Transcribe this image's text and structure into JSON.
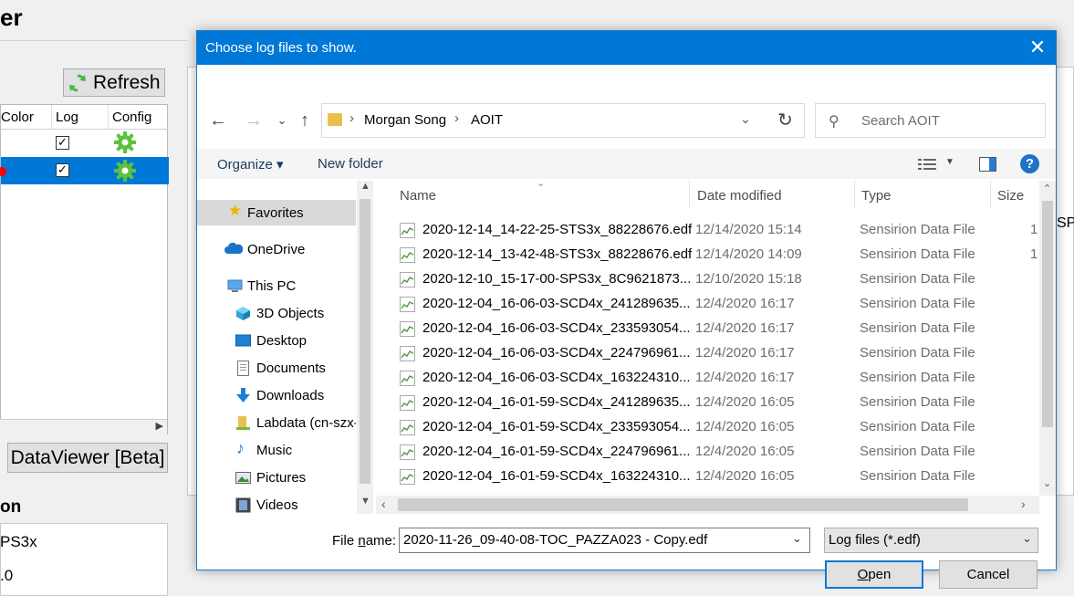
{
  "background_app": {
    "title_fragment": "er",
    "refresh_label": "Refresh",
    "table_headers": [
      "Color",
      "Log",
      "Config"
    ],
    "rows": [
      {
        "log": "✓",
        "selected": false,
        "color": ""
      },
      {
        "log": "✓",
        "selected": true,
        "color": "#ff0000"
      }
    ],
    "dataviewer_label": "DataViewer [Beta]",
    "section_label": "on",
    "info_line1": "PS3x",
    "info_line2": ".0",
    "right_fragment": "SPS"
  },
  "dialog": {
    "title": "Choose log files to show.",
    "close_glyph": "✕",
    "breadcrumb": [
      "Morgan Song",
      "AOIT"
    ],
    "search_placeholder": "Search AOIT",
    "toolbar": {
      "organize": "Organize ▾",
      "new_folder": "New folder",
      "help": "?"
    },
    "nav_items": [
      {
        "label": "Favorites",
        "icon": "star-icon"
      },
      {
        "label": "OneDrive",
        "icon": "cloud-icon"
      },
      {
        "label": "This PC",
        "icon": "computer-icon"
      },
      {
        "label": "3D Objects",
        "icon": "cube-icon"
      },
      {
        "label": "Desktop",
        "icon": "desktop-icon"
      },
      {
        "label": "Documents",
        "icon": "document-icon"
      },
      {
        "label": "Downloads",
        "icon": "download-icon"
      },
      {
        "label": "Labdata (cn-szx-",
        "icon": "network-drive-icon"
      },
      {
        "label": "Music",
        "icon": "music-icon"
      },
      {
        "label": "Pictures",
        "icon": "pictures-icon"
      },
      {
        "label": "Videos",
        "icon": "videos-icon"
      }
    ],
    "columns": [
      "Name",
      "Date modified",
      "Type",
      "Size"
    ],
    "files": [
      {
        "name": "2020-12-14_14-22-25-STS3x_88228676.edf",
        "date": "12/14/2020 15:14",
        "type": "Sensirion Data File",
        "size": "1"
      },
      {
        "name": "2020-12-14_13-42-48-STS3x_88228676.edf",
        "date": "12/14/2020 14:09",
        "type": "Sensirion Data File",
        "size": "1"
      },
      {
        "name": "2020-12-10_15-17-00-SPS3x_8C9621873...",
        "date": "12/10/2020 15:18",
        "type": "Sensirion Data File",
        "size": ""
      },
      {
        "name": "2020-12-04_16-06-03-SCD4x_241289635...",
        "date": "12/4/2020 16:17",
        "type": "Sensirion Data File",
        "size": ""
      },
      {
        "name": "2020-12-04_16-06-03-SCD4x_233593054...",
        "date": "12/4/2020 16:17",
        "type": "Sensirion Data File",
        "size": ""
      },
      {
        "name": "2020-12-04_16-06-03-SCD4x_224796961...",
        "date": "12/4/2020 16:17",
        "type": "Sensirion Data File",
        "size": ""
      },
      {
        "name": "2020-12-04_16-06-03-SCD4x_163224310...",
        "date": "12/4/2020 16:17",
        "type": "Sensirion Data File",
        "size": ""
      },
      {
        "name": "2020-12-04_16-01-59-SCD4x_241289635...",
        "date": "12/4/2020 16:05",
        "type": "Sensirion Data File",
        "size": ""
      },
      {
        "name": "2020-12-04_16-01-59-SCD4x_233593054...",
        "date": "12/4/2020 16:05",
        "type": "Sensirion Data File",
        "size": ""
      },
      {
        "name": "2020-12-04_16-01-59-SCD4x_224796961...",
        "date": "12/4/2020 16:05",
        "type": "Sensirion Data File",
        "size": ""
      },
      {
        "name": "2020-12-04_16-01-59-SCD4x_163224310...",
        "date": "12/4/2020 16:05",
        "type": "Sensirion Data File",
        "size": ""
      }
    ],
    "file_name_label_pre": "File ",
    "file_name_label_ul": "n",
    "file_name_label_post": "ame:",
    "file_name_value": "2020-11-26_09-40-08-TOC_PAZZA023 - Copy.edf",
    "file_type_value": "Log files (*.edf)",
    "open_label_ul": "O",
    "open_label_rest": "pen",
    "cancel_label": "Cancel"
  },
  "colors": {
    "title_bar": "#0078d7",
    "selected_row": "#0078d7",
    "gear": "#5cc13b"
  }
}
